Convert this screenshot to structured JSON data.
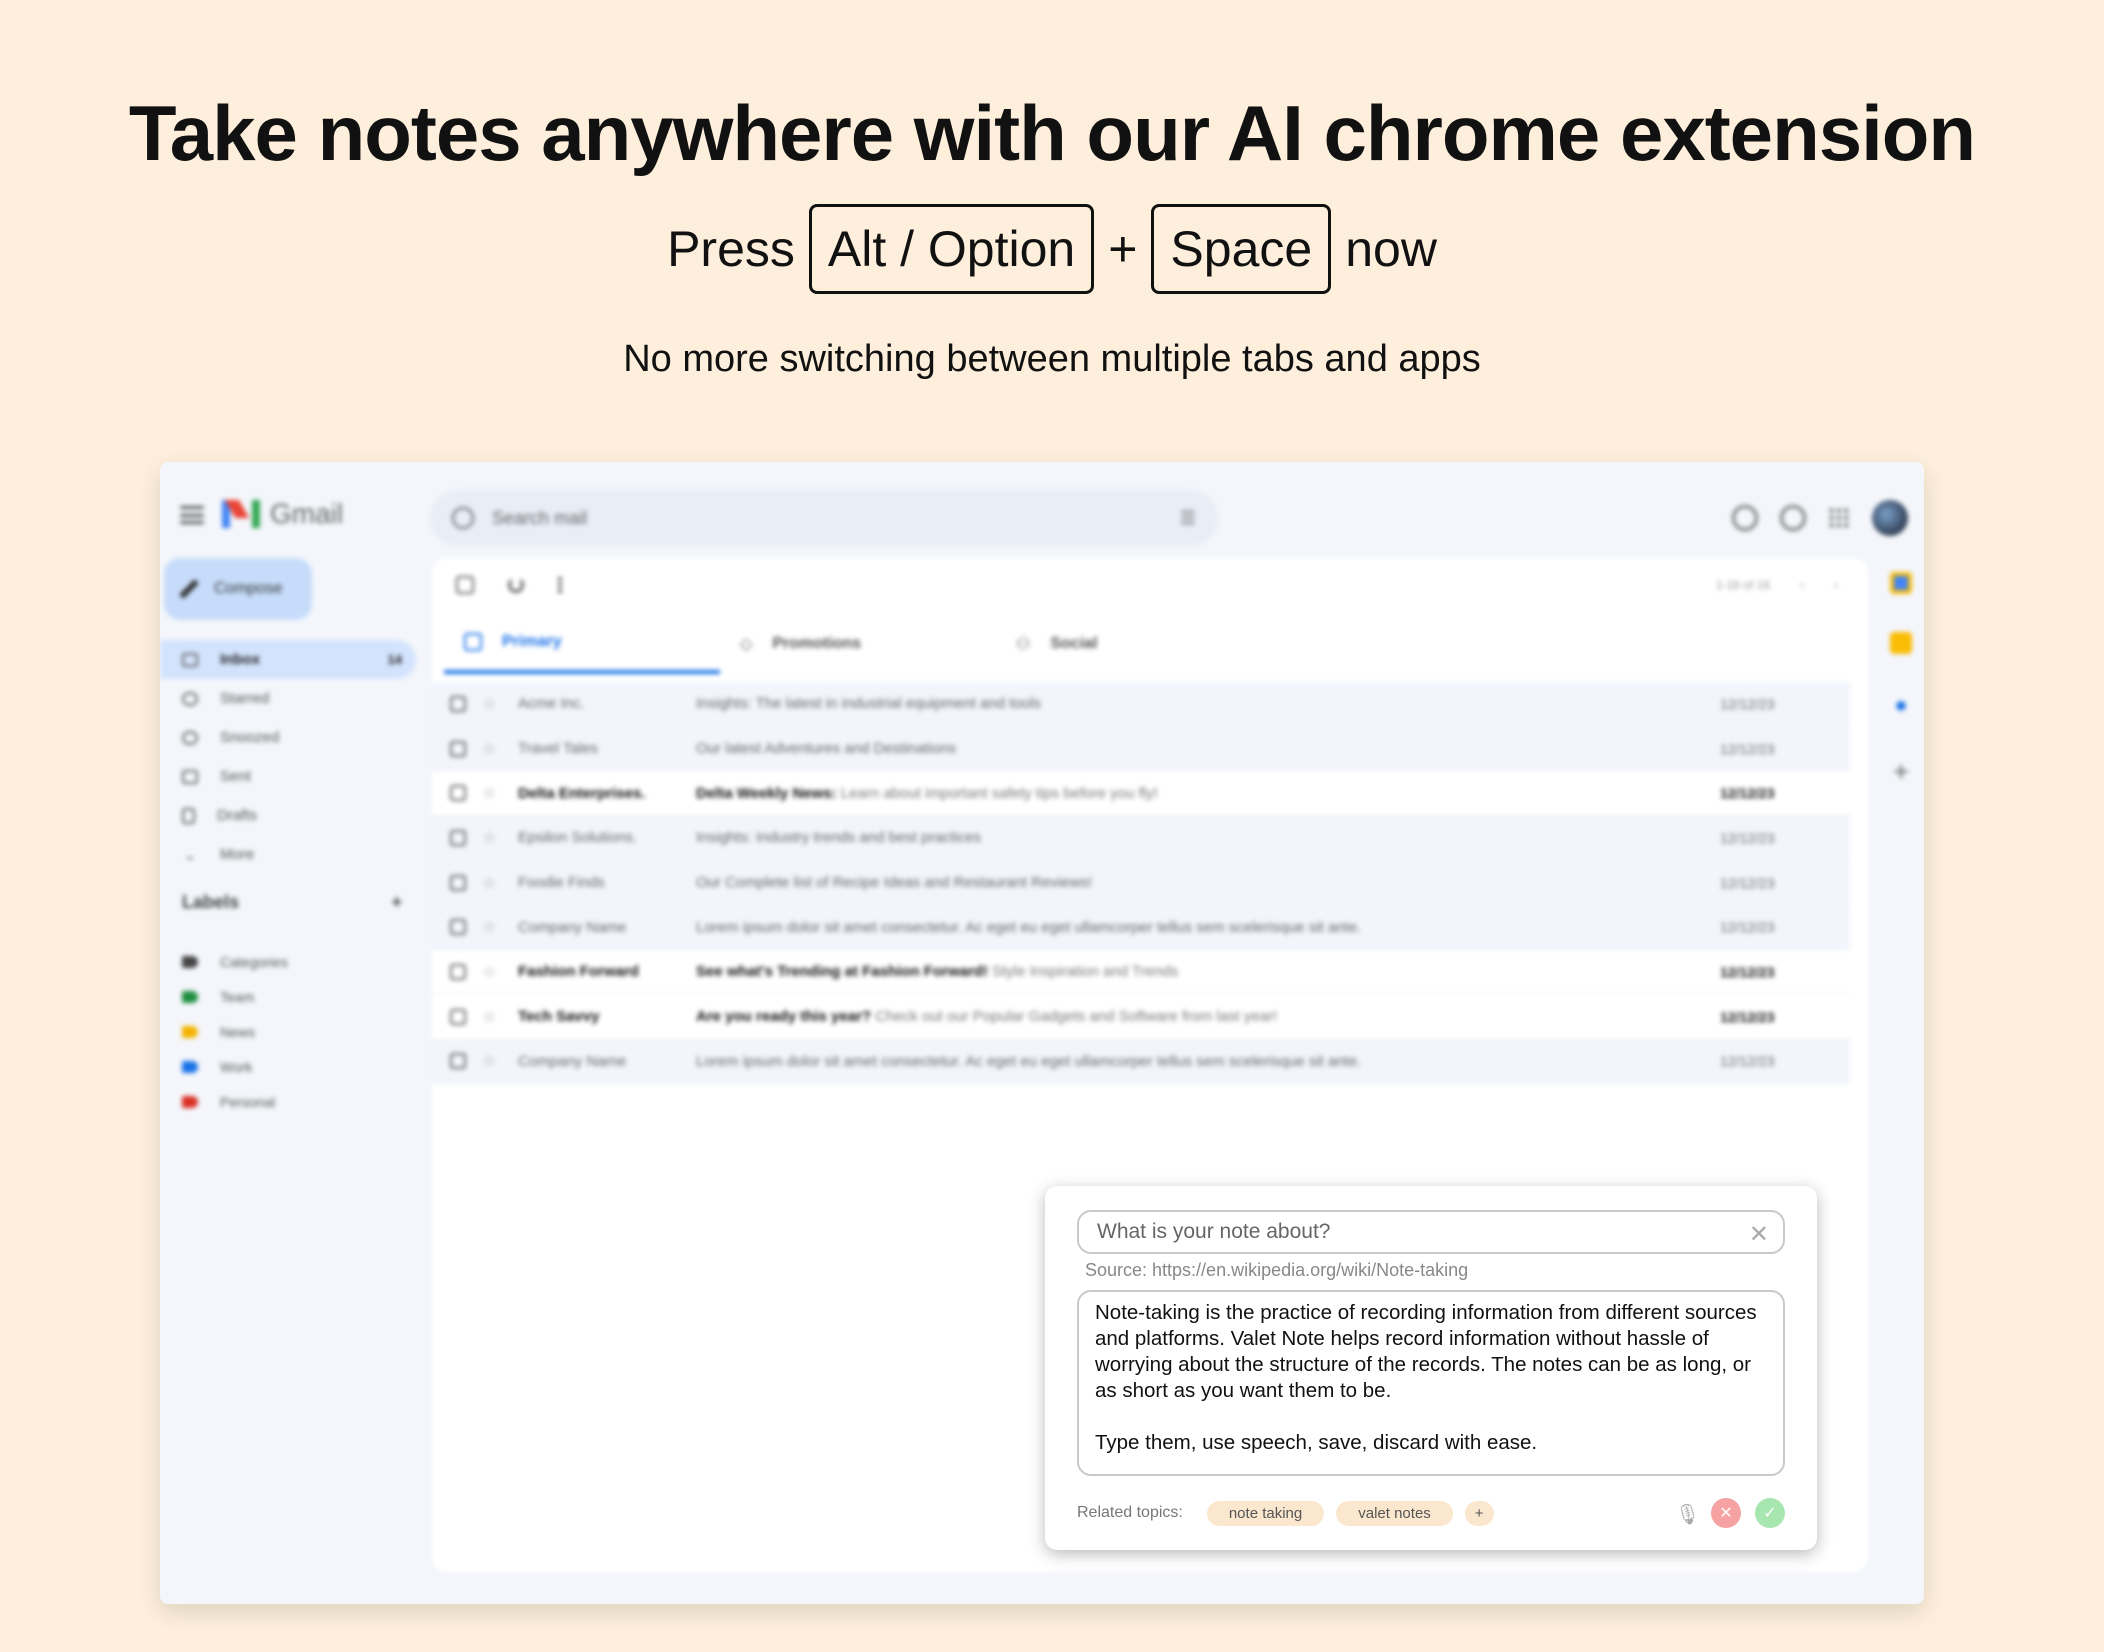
{
  "hero": {
    "title": "Take notes anywhere with our AI chrome extension",
    "press_word": "Press",
    "key1": "Alt / Option",
    "plus": "+",
    "key2": "Space",
    "now_word": "now",
    "subtitle": "No more switching between multiple tabs and apps"
  },
  "gmail": {
    "logo_text": "Gmail",
    "search_placeholder": "Search mail",
    "compose_label": "Compose",
    "nav": [
      {
        "label": "Inbox",
        "count": "14"
      },
      {
        "label": "Starred"
      },
      {
        "label": "Snoozed"
      },
      {
        "label": "Sent"
      },
      {
        "label": "Drafts"
      },
      {
        "label": "More"
      }
    ],
    "labels_title": "Labels",
    "labels_add": "+",
    "labels": [
      {
        "label": "Categories",
        "color": "#444444"
      },
      {
        "label": "Team",
        "color": "#1e8e3e"
      },
      {
        "label": "News",
        "color": "#f4b400"
      },
      {
        "label": "Work",
        "color": "#1a73e8"
      },
      {
        "label": "Personal",
        "color": "#d93025"
      }
    ],
    "pager_text": "1-16 of 16",
    "pager_prev": "‹",
    "pager_next": "›",
    "tabs": [
      {
        "label": "Primary"
      },
      {
        "label": "Promotions"
      },
      {
        "label": "Social"
      }
    ],
    "emails": [
      {
        "sender": "Acme Inc.",
        "subject": "Insights: The latest in industrial equipment and tools",
        "snippet": "",
        "date": "12/12/23",
        "unread": false
      },
      {
        "sender": "Travel Tales",
        "subject": "Our latest Adventures and Destinations",
        "snippet": "",
        "date": "12/12/23",
        "unread": false
      },
      {
        "sender": "Delta Enterprises.",
        "subject": "Delta Weekly News:",
        "snippet": "Learn about important safety tips before you fly!",
        "date": "12/12/23",
        "unread": true
      },
      {
        "sender": "Epsilon Solutions.",
        "subject": "Insights: Industry trends and best practices",
        "snippet": "",
        "date": "12/12/23",
        "unread": false
      },
      {
        "sender": "Foodie Finds",
        "subject": "Our Complete list of Recipe Ideas and Restaurant Reviews!",
        "snippet": "",
        "date": "12/12/23",
        "unread": false
      },
      {
        "sender": "Company Name",
        "subject": "Lorem ipsum dolor sit amet consectetur. Ac eget eu eget ullamcorper tellus sem scelerisque sit ante.",
        "snippet": "",
        "date": "12/12/23",
        "unread": false
      },
      {
        "sender": "Fashion Forward",
        "subject": "See what's Trending at Fashion Forward!",
        "snippet": "Style Inspiration and Trends",
        "date": "12/12/23",
        "unread": true
      },
      {
        "sender": "Tech Savvy",
        "subject": "Are you ready this year?",
        "snippet": "Check out our Popular Gadgets and Software from last year!",
        "date": "12/12/23",
        "unread": true
      },
      {
        "sender": "Company Name",
        "subject": "Lorem ipsum dolor sit amet consectetur. Ac eget eu eget ullamcorper tellus sem scelerisque sit ante.",
        "snippet": "",
        "date": "12/12/23",
        "unread": false
      }
    ],
    "side_plus": "+"
  },
  "note": {
    "title_placeholder": "What is your note about?",
    "close_glyph": "✕",
    "source": "Source: https://en.wikipedia.org/wiki/Note-taking",
    "body": "Note-taking is the practice of recording information from different sources and platforms. Valet Note helps record information without hassle of worrying about the structure of the records. The notes can be as long, or as short as you want them to be.\n\nType them, use speech, save, discard with ease.",
    "related_label": "Related topics:",
    "topics": [
      "note taking",
      "valet notes"
    ],
    "add_topic": "+"
  },
  "colors": {
    "page_bg": "#fdefdb",
    "accent": "#1a73e8",
    "discard": "#f7a2a2",
    "save": "#a8e6b0"
  }
}
